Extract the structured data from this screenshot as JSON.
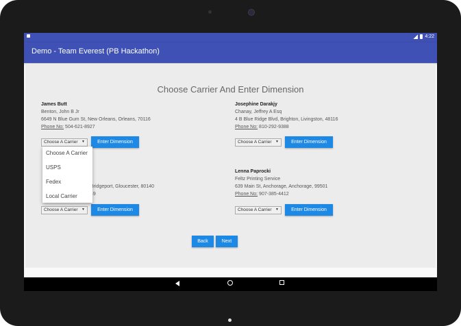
{
  "status_bar": {
    "time": "4:22"
  },
  "app_bar": {
    "title": "Demo - Team Everest (PB Hackathon)"
  },
  "page": {
    "heading": "Choose Carrier And Enter Dimension"
  },
  "customers": [
    {
      "name": "James Butt",
      "company": "Benton, John B Jr",
      "address": "6649 N Blue Gum St, New Orleans, Orleans, 70116",
      "phone_label": "Phone No:",
      "phone": "504-621-8927",
      "carrier_select": "Choose A Carrier",
      "button": "Enter Dimension"
    },
    {
      "name": "Josephine Darakjy",
      "company": "Chanay, Jeffrey A Esq",
      "address": "4 B Blue Ridge Blvd, Brighton, Livingston, 48116",
      "phone_label": "Phone No:",
      "phone": "810-292-9388",
      "carrier_select": "Choose A Carrier",
      "button": "Enter Dimension"
    },
    {
      "address_partial": "Bridgeport, Gloucester, 80140",
      "phone_partial": "49",
      "carrier_select": "Choose A Carrier",
      "button": "Enter Dimension"
    },
    {
      "name": "Lenna Paprocki",
      "company": "Feltz Printing Service",
      "address": "639 Main St, Anchorage, Anchorage, 99501",
      "phone_label": "Phone No:",
      "phone": "907-385-4412",
      "carrier_select": "Choose A Carrier",
      "button": "Enter Dimension"
    }
  ],
  "carrier_dropdown": {
    "options": [
      "Choose A Carrier",
      "USPS",
      "Fedex",
      "Local Carrier"
    ]
  },
  "footer_buttons": {
    "back": "Back",
    "next": "Next"
  },
  "system_nav": {
    "back_icon": "triangle-back-icon",
    "home_icon": "circle-home-icon",
    "recents_icon": "square-recents-icon"
  }
}
